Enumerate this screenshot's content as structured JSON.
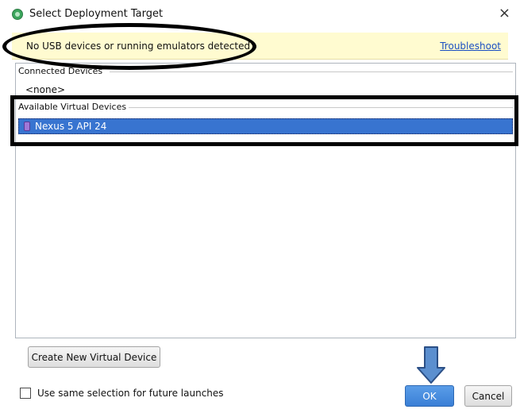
{
  "window": {
    "title": "Select Deployment Target",
    "close_glyph": "×",
    "app_icon": "android-studio-icon"
  },
  "banner": {
    "message": "No USB devices or running emulators detected",
    "troubleshoot_link": "Troubleshoot",
    "background": "#fffbd0"
  },
  "devices": {
    "connected_label": "Connected Devices",
    "connected_items": [
      "<none>"
    ],
    "available_label": "Available Virtual Devices",
    "available_items": [
      {
        "label": "Nexus 5 API 24",
        "icon": "phone-icon",
        "selected": true
      }
    ],
    "selection_color": "#3874d0"
  },
  "footer": {
    "create_button": "Create New Virtual Device",
    "checkbox_label": "Use same selection for future launches",
    "checkbox_checked": false,
    "ok_button": "OK",
    "cancel_button": "Cancel"
  }
}
